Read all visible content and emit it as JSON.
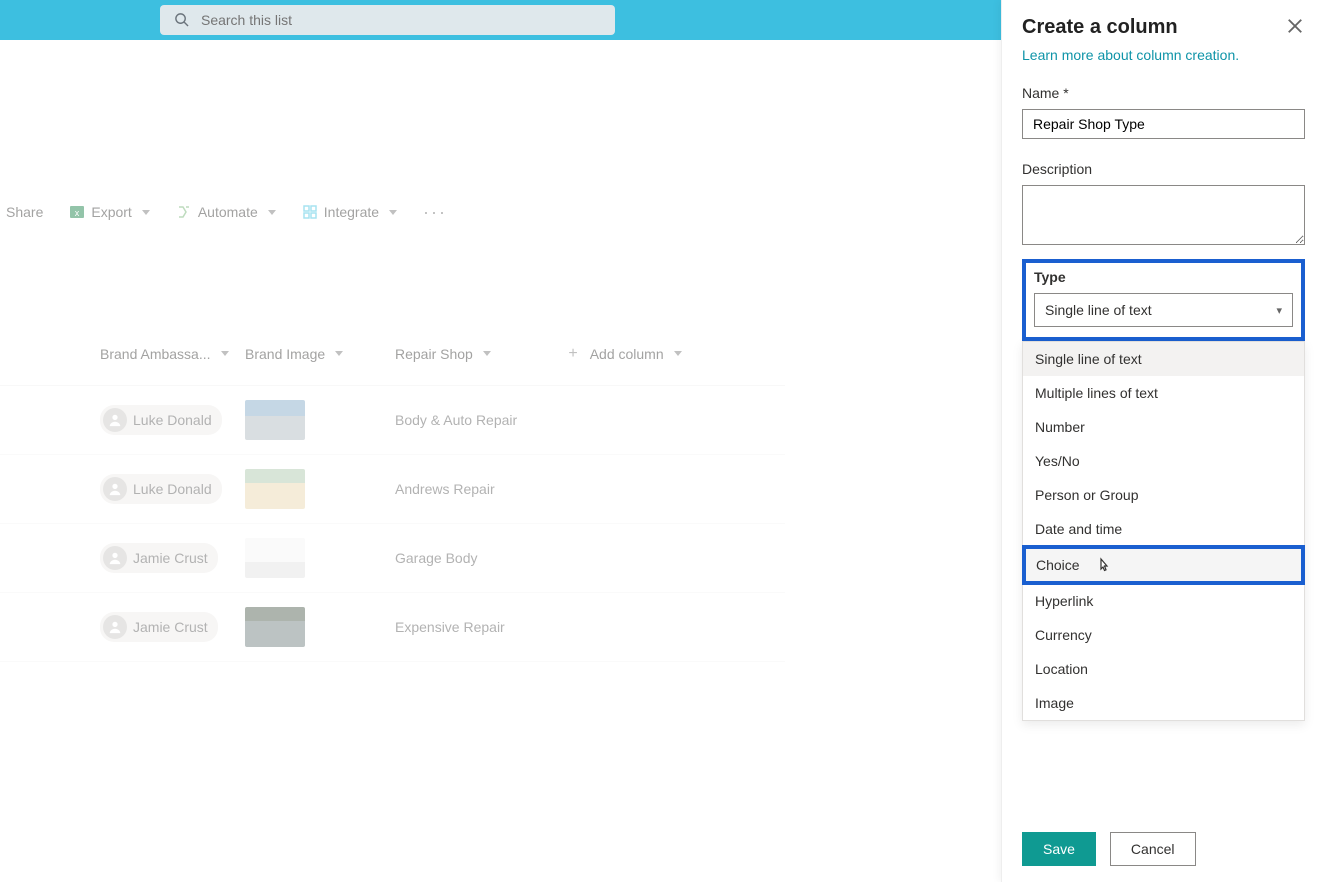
{
  "search": {
    "placeholder": "Search this list"
  },
  "commands": {
    "share": "Share",
    "export": "Export",
    "automate": "Automate",
    "integrate": "Integrate"
  },
  "columns": {
    "ambassador": "Brand Ambassa...",
    "image": "Brand Image",
    "repair": "Repair Shop",
    "add": "Add column"
  },
  "rows": [
    {
      "ambassador": "Luke Donald",
      "repair": "Body & Auto Repair"
    },
    {
      "ambassador": "Luke Donald",
      "repair": "Andrews Repair"
    },
    {
      "ambassador": "Jamie Crust",
      "repair": "Garage Body"
    },
    {
      "ambassador": "Jamie Crust",
      "repair": "Expensive Repair"
    }
  ],
  "panel": {
    "title": "Create a column",
    "learn": "Learn more about column creation.",
    "name_label": "Name *",
    "name_value": "Repair Shop Type",
    "desc_label": "Description",
    "type_label": "Type",
    "type_selected": "Single line of text",
    "options": [
      "Single line of text",
      "Multiple lines of text",
      "Number",
      "Yes/No",
      "Person or Group",
      "Date and time",
      "Choice",
      "Hyperlink",
      "Currency",
      "Location",
      "Image"
    ],
    "save": "Save",
    "cancel": "Cancel"
  }
}
